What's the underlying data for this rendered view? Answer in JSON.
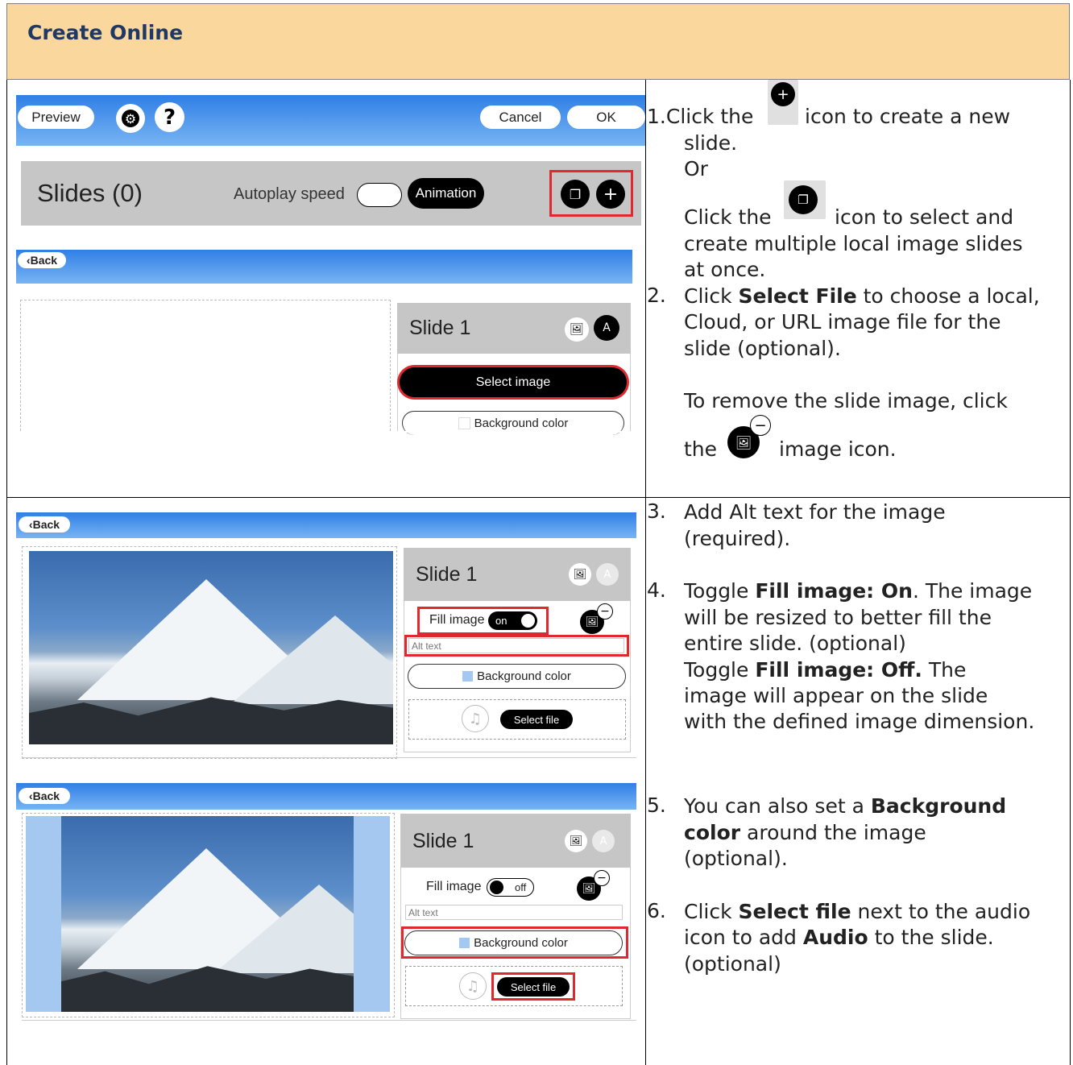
{
  "header": {
    "title": "Create Online"
  },
  "shot1": {
    "toolbar": {
      "preview": "Preview",
      "help": "?",
      "cancel": "Cancel",
      "ok": "OK"
    },
    "slides_title": "Slides (0)",
    "autoplay_label": "Autoplay speed",
    "animation": "Animation"
  },
  "shot2": {
    "back": "Back",
    "slide_title": "Slide 1",
    "select_image": "Select image",
    "bg_color": "Background color"
  },
  "shot3": {
    "back": "Back",
    "slide_title": "Slide 1",
    "fill_label": "Fill image",
    "fill_state": "on",
    "alt_placeholder": "Alt text",
    "bg_color": "Background color",
    "select_file": "Select file"
  },
  "shot4": {
    "back": "Back",
    "slide_title": "Slide 1",
    "fill_label": "Fill image",
    "fill_state": "off",
    "alt_placeholder": "Alt text",
    "bg_color": "Background color",
    "select_file": "Select file"
  },
  "steps": {
    "s1_num": "1.",
    "s1_a": "Click the",
    "s1_b": "icon to create a new",
    "s1_c": "slide.",
    "s1_or": "Or",
    "s1_d": "Click the",
    "s1_e": "icon to select and",
    "s1_f": "create multiple local image slides",
    "s1_g": "at once.",
    "s2_num": "2.",
    "s2_a": "Click",
    "s2_bold": "Select File",
    "s2_b": "to choose a local,",
    "s2_c": "Cloud, or URL image file for the",
    "s2_d": "slide (optional).",
    "s2_e": "To remove the slide image, click",
    "s2_f": "the",
    "s2_g": "image icon.",
    "s3_num": "3.",
    "s3_a": "Add Alt text for the image",
    "s3_b": "(required).",
    "s4_num": "4.",
    "s4_a": "Toggle",
    "s4_bold1": "Fill image: On",
    "s4_b": ". The image",
    "s4_c": "will be resized to better fill the",
    "s4_d": "entire slide. (optional)",
    "s4_e": "Toggle",
    "s4_bold2": "Fill image: Off.",
    "s4_f": "The",
    "s4_g": "image will appear on the slide",
    "s4_h": "with the defined image dimension.",
    "s5_num": "5.",
    "s5_a": "You can also set a",
    "s5_bold1": "Background",
    "s5_bold2": "color",
    "s5_b": "around the image",
    "s5_c": "(optional).",
    "s6_num": "6.",
    "s6_a": "Click",
    "s6_bold1": "Select file",
    "s6_b": "next to the audio",
    "s6_c": "icon to add",
    "s6_bold2": "Audio",
    "s6_d": "to the slide.",
    "s6_e": "(optional)"
  },
  "colors": {
    "header_bg": "#fad89d",
    "title": "#1f3864",
    "highlight": "#e0282f",
    "bar_blue": "#2f7fe6",
    "swatch": "#a4c8f0"
  }
}
